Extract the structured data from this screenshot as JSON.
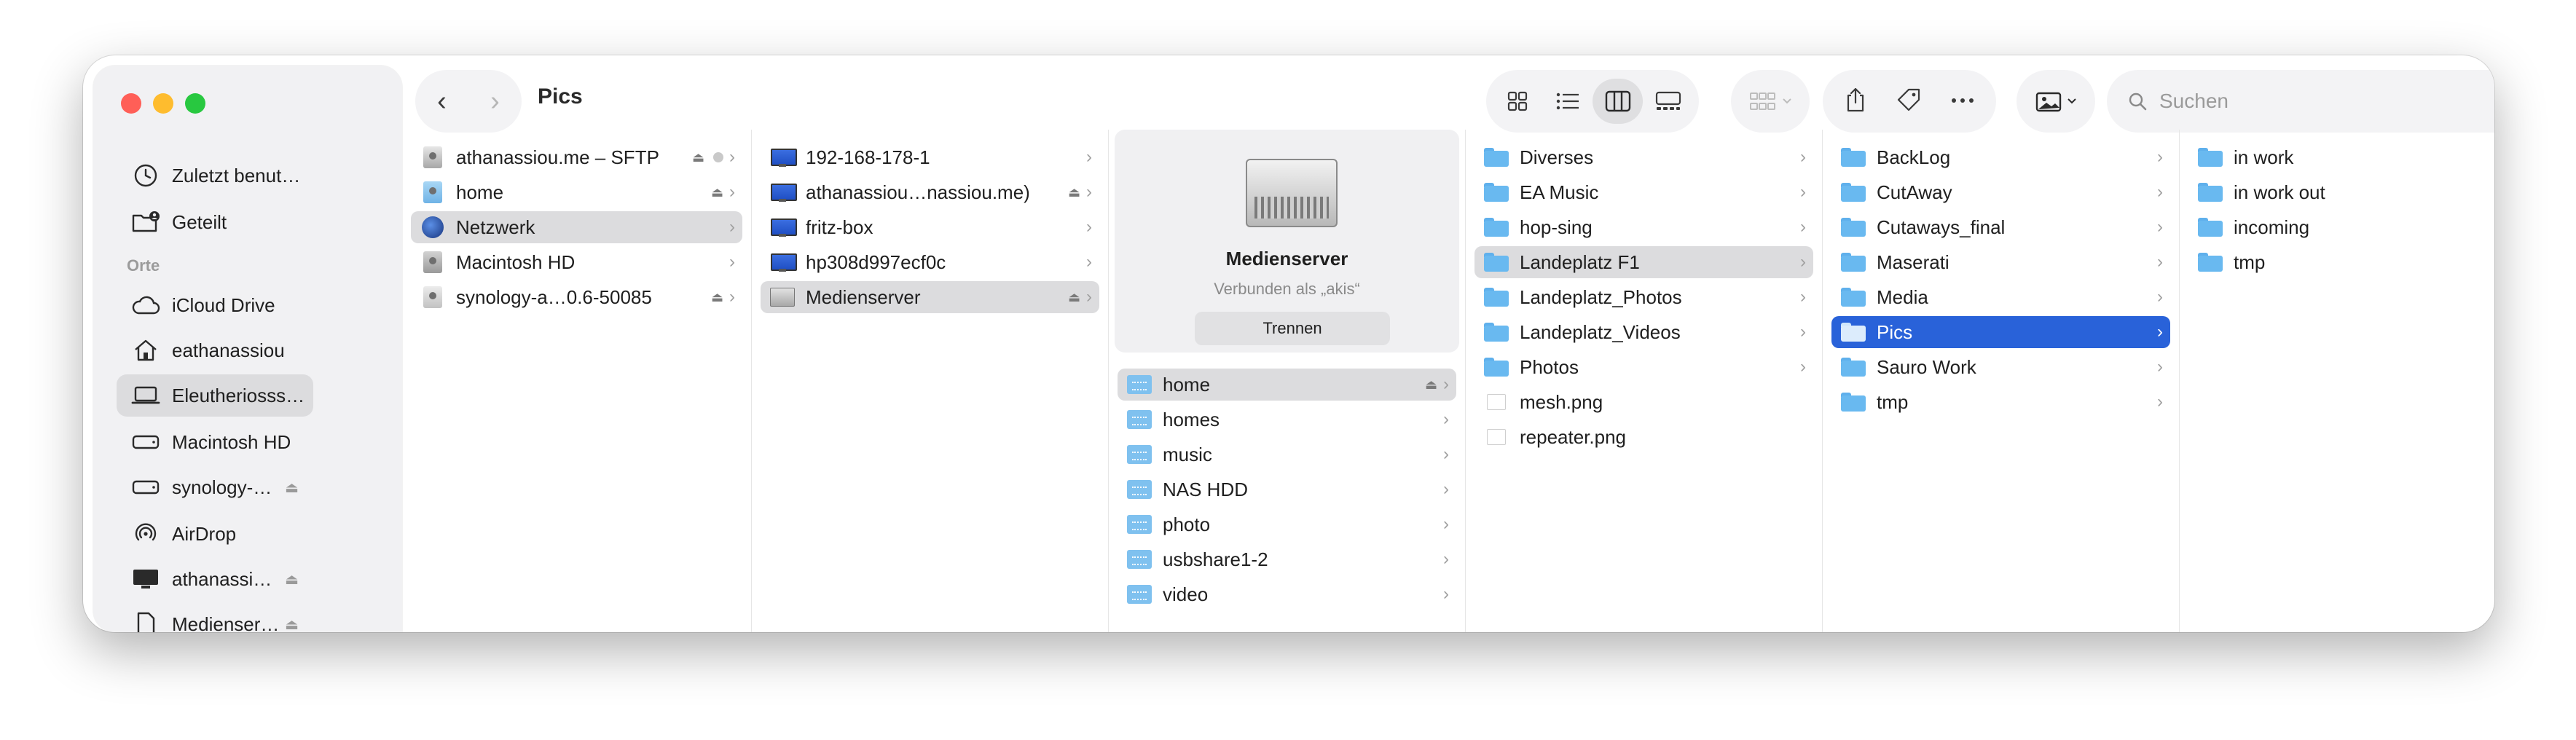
{
  "window": {
    "title": "Pics"
  },
  "toolbar": {
    "back": "‹",
    "forward": "›",
    "search_placeholder": "Suchen"
  },
  "sidebar": {
    "section_orte": "Orte",
    "items": [
      {
        "label": "Zuletzt benut…",
        "icon": "clock-icon"
      },
      {
        "label": "Geteilt",
        "icon": "shared-folder-icon"
      },
      {
        "label": "iCloud Drive",
        "icon": "cloud-icon"
      },
      {
        "label": "eathanassiou",
        "icon": "home-icon"
      },
      {
        "label": "Eleutheriosss…",
        "icon": "laptop-icon"
      },
      {
        "label": "Macintosh HD",
        "icon": "disk-icon"
      },
      {
        "label": "synology-…",
        "icon": "disk-icon"
      },
      {
        "label": "AirDrop",
        "icon": "airdrop-icon"
      },
      {
        "label": "athanassi…",
        "icon": "monitor-icon"
      },
      {
        "label": "Medienser…",
        "icon": "document-icon"
      }
    ]
  },
  "columns": {
    "locations": [
      {
        "label": "athanassiou.me – SFTP"
      },
      {
        "label": "home"
      },
      {
        "label": "Netzwerk"
      },
      {
        "label": "Macintosh HD"
      },
      {
        "label": "synology-a…0.6-50085"
      }
    ],
    "network": [
      {
        "label": "192-168-178-1"
      },
      {
        "label": "athanassiou…nassiou.me)"
      },
      {
        "label": "fritz-box"
      },
      {
        "label": "hp308d997ecf0c"
      },
      {
        "label": "Medienserver"
      }
    ],
    "server": {
      "name": "Medienserver",
      "status": "Verbunden als „akis“",
      "disconnect": "Trennen",
      "shares": [
        {
          "label": "home"
        },
        {
          "label": "homes"
        },
        {
          "label": "music"
        },
        {
          "label": "NAS HDD"
        },
        {
          "label": "photo"
        },
        {
          "label": "usbshare1-2"
        },
        {
          "label": "video"
        }
      ]
    },
    "home": [
      {
        "label": "Diverses"
      },
      {
        "label": "EA Music"
      },
      {
        "label": "hop-sing"
      },
      {
        "label": "Landeplatz F1"
      },
      {
        "label": "Landeplatz_Photos"
      },
      {
        "label": "Landeplatz_Videos"
      },
      {
        "label": "Photos"
      },
      {
        "label": "mesh.png"
      },
      {
        "label": "repeater.png"
      }
    ],
    "landeplatz": [
      {
        "label": "BackLog"
      },
      {
        "label": "CutAway"
      },
      {
        "label": "Cutaways_final"
      },
      {
        "label": "Maserati"
      },
      {
        "label": "Media"
      },
      {
        "label": "Pics"
      },
      {
        "label": "Sauro Work"
      },
      {
        "label": "tmp"
      }
    ],
    "pics": [
      {
        "label": "in work"
      },
      {
        "label": "in work out"
      },
      {
        "label": "incoming"
      },
      {
        "label": "tmp"
      }
    ]
  },
  "colors": {
    "accent": "#2962d9",
    "folder": "#69b9f0",
    "selection_gray": "#dcdcde"
  }
}
